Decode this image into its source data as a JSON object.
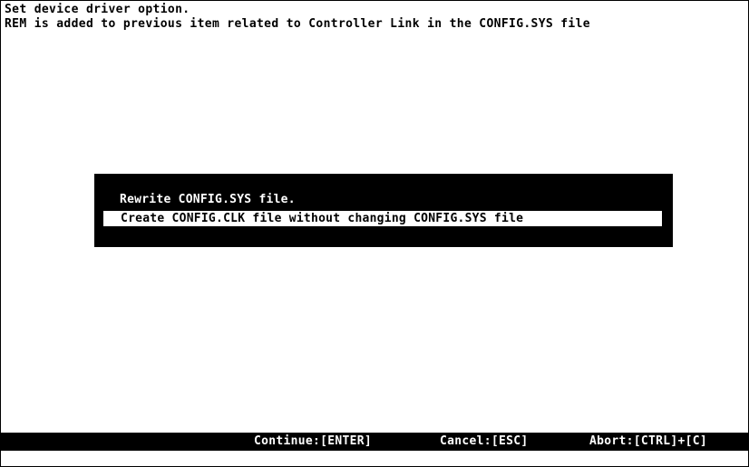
{
  "header": {
    "line1": "Set device driver option.",
    "line2": "REM is added to previous item related to Controller Link in the CONFIG.SYS file"
  },
  "dialog": {
    "options": [
      {
        "label": "Rewrite CONFIG.SYS file.",
        "selected": false
      },
      {
        "label": "Create CONFIG.CLK file without changing CONFIG.SYS file",
        "selected": true
      }
    ]
  },
  "status_bar": {
    "continue": "Continue:[ENTER]",
    "cancel": "Cancel:[ESC]",
    "abort": "Abort:[CTRL]+[C]"
  },
  "colors": {
    "background": "#ffffff",
    "foreground": "#000000",
    "highlight": "#ffffff"
  }
}
